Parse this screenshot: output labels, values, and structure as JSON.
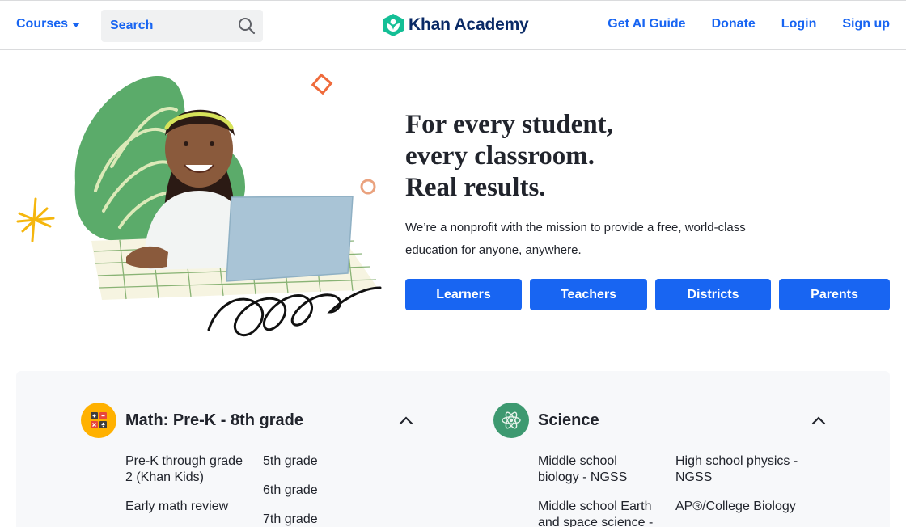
{
  "header": {
    "courses_label": "Courses",
    "search_placeholder": "Search",
    "logo_text": "Khan Academy",
    "nav": [
      "Get AI Guide",
      "Donate",
      "Login",
      "Sign up"
    ]
  },
  "hero": {
    "headline": [
      "For every student,",
      "every classroom.",
      "Real results."
    ],
    "subtext": "We’re a nonprofit with the mission to provide a free, world-class education for anyone, anywhere.",
    "buttons": [
      "Learners",
      "Teachers",
      "Districts",
      "Parents"
    ]
  },
  "subjects": [
    {
      "title": "Math: Pre-K - 8th grade",
      "icon": "math-icon",
      "icon_color": "#ffb100",
      "column_a": [
        "Pre-K through grade 2 (Khan Kids)",
        "Early math review"
      ],
      "column_b": [
        "5th grade",
        "6th grade",
        "7th grade"
      ]
    },
    {
      "title": "Science",
      "icon": "atom-icon",
      "icon_color": "#3d9970",
      "column_a": [
        "Middle school biology - NGSS",
        "Middle school Earth and space science - NGSS"
      ],
      "column_b": [
        "High school physics - NGSS",
        "AP®/College Biology"
      ]
    }
  ],
  "colors": {
    "brand_blue": "#1865f2",
    "logo_green": "#14bf96",
    "logo_navy": "#0a2a66"
  }
}
